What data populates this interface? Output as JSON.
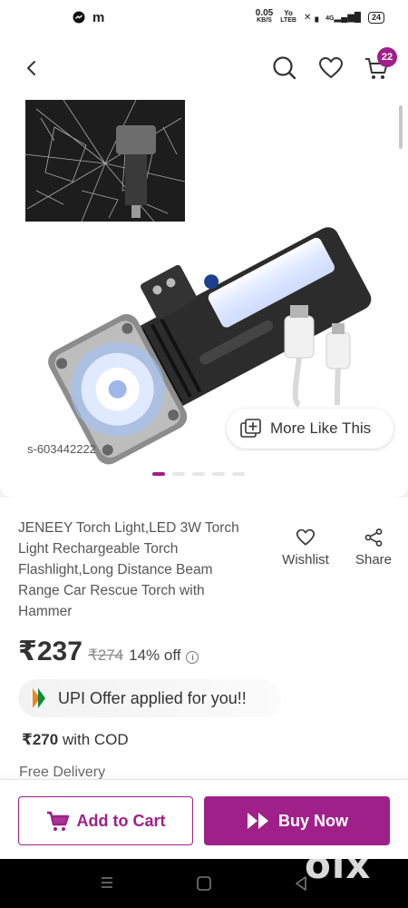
{
  "status_bar": {
    "net_speed_top": "0.05",
    "net_speed_unit": "KB/S",
    "volte_top": "Yo",
    "volte_bottom": "LTEB",
    "network": "4G",
    "battery": "24"
  },
  "header": {
    "cart_count": "22"
  },
  "gallery": {
    "more_like_label": "More Like This",
    "sku": "s-603442222",
    "slide_count": 5,
    "active_slide": 1
  },
  "product": {
    "title": "JENEEY  Torch Light,LED 3W Torch Light Rechargeable Torch Flashlight,Long Distance Beam Range Car Rescue Torch with Hammer",
    "wishlist_label": "Wishlist",
    "share_label": "Share",
    "price": "₹237",
    "mrp": "₹274",
    "discount": "14% off",
    "info_symbol": "i",
    "upi_offer": "UPI Offer applied for you!!",
    "cod_price": "₹270",
    "cod_label": "with COD",
    "delivery": "Free Delivery"
  },
  "actions": {
    "add_to_cart": "Add to Cart",
    "buy_now": "Buy Now"
  },
  "watermark": "olx",
  "colors": {
    "brand": "#9f2089"
  }
}
